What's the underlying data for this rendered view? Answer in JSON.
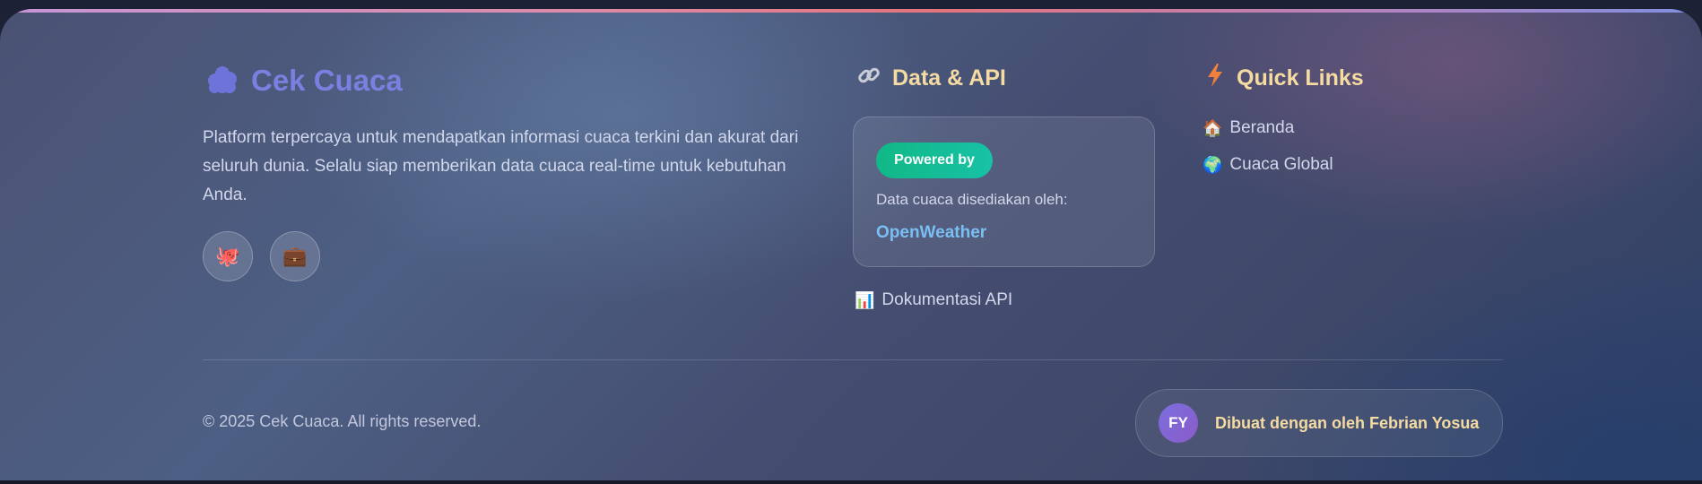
{
  "brand": {
    "title": "Cek Cuaca",
    "icon": "cloud-icon",
    "description": "Platform terpercaya untuk mendapatkan informasi cuaca terkini dan akurat dari seluruh dunia. Selalu siap memberikan data cuaca real-time untuk kebutuhan Anda.",
    "social": [
      {
        "icon": "octopus-icon",
        "glyph": "🐙"
      },
      {
        "icon": "briefcase-icon",
        "glyph": "💼"
      }
    ]
  },
  "data_api": {
    "title": "Data & API",
    "icon": "link-icon",
    "badge": "Powered by",
    "provided_by": "Data cuaca disediakan oleh:",
    "provider": "OpenWeather",
    "docs_link": {
      "label": "Dokumentasi API",
      "icon": "bar-chart-icon",
      "glyph": "📊"
    }
  },
  "quick_links": {
    "title": "Quick Links",
    "icon": "lightning-icon",
    "items": [
      {
        "label": "Beranda",
        "icon": "house-icon",
        "glyph": "🏠"
      },
      {
        "label": "Cuaca Global",
        "icon": "globe-icon",
        "glyph": "🌍"
      }
    ]
  },
  "footer_bottom": {
    "copyright": "© 2025 Cek Cuaca. All rights reserved.",
    "avatar_initials": "FY",
    "credit": "Dibuat dengan oleh Febrian Yosua"
  },
  "colors": {
    "brand_title": "#7a80e0",
    "heading": "#f5dba1",
    "badge": "#12b886",
    "link_accent": "#79bff4",
    "avatar": "#7b6fe0"
  }
}
